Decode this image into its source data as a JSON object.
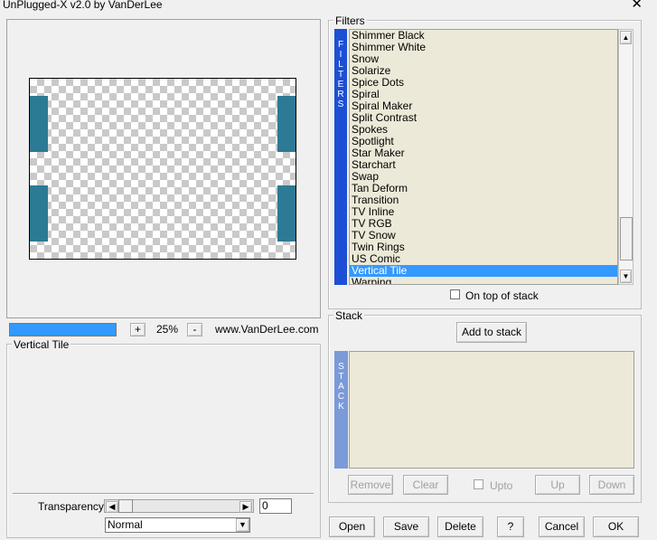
{
  "window": {
    "title": "UnPlugged-X v2.0 by VanDerLee",
    "close_icon": "close-icon"
  },
  "preview": {
    "tile_color": "#2c7a94"
  },
  "zoom": {
    "progress_percent": 100,
    "plus_label": "+",
    "value": "25%",
    "minus_label": "-",
    "website": "www.VanDerLee.com"
  },
  "effect": {
    "group_label": "Vertical Tile",
    "transparency_label": "Transparency",
    "transparency_value": "0",
    "blend_mode": "Normal"
  },
  "filters": {
    "group_label": "Filters",
    "strip_letters": [
      "F",
      "I",
      "L",
      "T",
      "E",
      "R",
      "S"
    ],
    "items": [
      "Shimmer Black",
      "Shimmer White",
      "Snow",
      "Solarize",
      "Spice Dots",
      "Spiral",
      "Spiral Maker",
      "Split Contrast",
      "Spokes",
      "Spotlight",
      "Star Maker",
      "Starchart",
      "Swap",
      "Tan Deform",
      "Transition",
      "TV Inline",
      "TV RGB",
      "TV Snow",
      "Twin Rings",
      "US Comic",
      "Vertical Tile",
      "Warping"
    ],
    "selected": "Vertical Tile",
    "on_top_label": "On top of stack",
    "scroll_up": "▲",
    "scroll_down": "▼"
  },
  "stack": {
    "group_label": "Stack",
    "add_label": "Add to stack",
    "strip_letters": [
      "S",
      "T",
      "A",
      "C",
      "K"
    ],
    "remove_label": "Remove",
    "clear_label": "Clear",
    "upto_label": "Upto",
    "up_label": "Up",
    "down_label": "Down"
  },
  "footer": {
    "open_label": "Open",
    "save_label": "Save",
    "delete_label": "Delete",
    "help_label": "?",
    "cancel_label": "Cancel",
    "ok_label": "OK"
  },
  "colors": {
    "selection": "#3399ff",
    "filters_strip": "#1c4fd6",
    "stack_strip": "#7b9ad8",
    "list_bg": "#ece9d8"
  }
}
